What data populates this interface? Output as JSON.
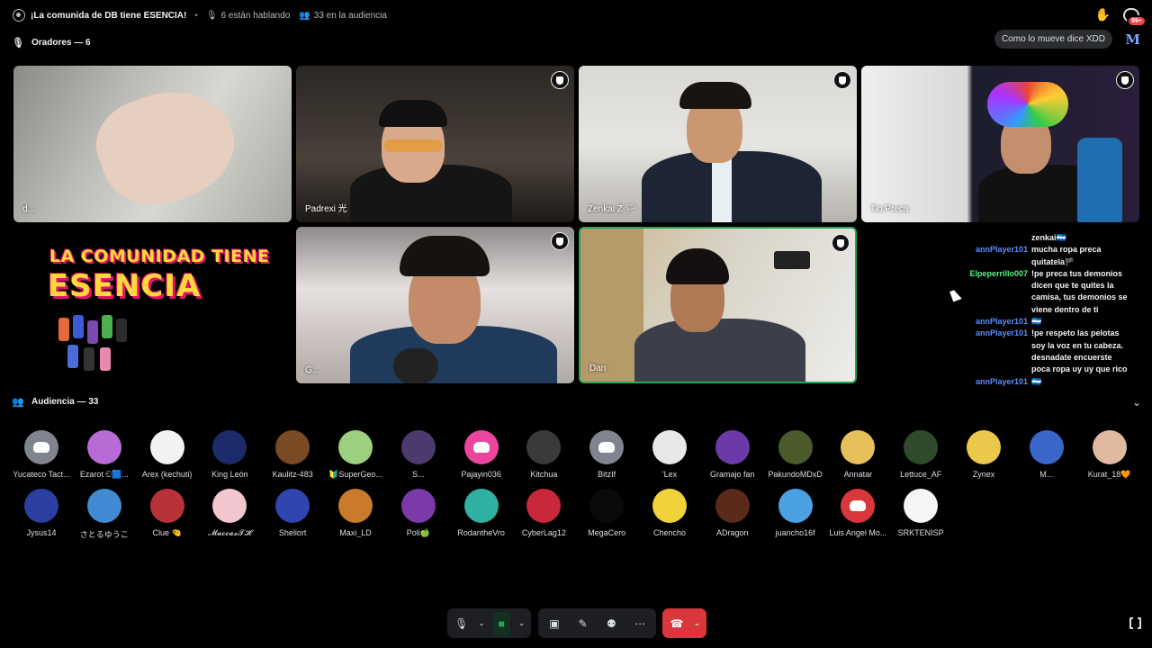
{
  "header": {
    "title": "¡La comunida de DB tiene ESENCIA!",
    "talking": "6 están hablando",
    "audience_count": "33 en la audiencia",
    "notif_badge": "99+"
  },
  "speakers": {
    "heading": "Oradores — 6",
    "tiles": [
      {
        "name": "d...",
        "moderator": false
      },
      {
        "name": "Padrexi 光",
        "moderator": true
      },
      {
        "name": "Zenkai Z 🏳",
        "moderator": true
      },
      {
        "name": "Tio Preca",
        "moderator": true
      },
      {
        "name": "G...",
        "moderator": true
      },
      {
        "name": "Dan",
        "moderator": true,
        "speaking": true
      }
    ]
  },
  "activity_pill": "Como lo mueve dice XDD",
  "brand_letter": "M",
  "banner": {
    "line1": "LA COMUNIDAD TIENE",
    "line2": "ESENCIA"
  },
  "chat": [
    {
      "user": "",
      "text": "zenkai🇭🇳",
      "color": "#5865f2"
    },
    {
      "user": "annPlayer101",
      "text": "mucha ropa preca",
      "color": "#5b8cff"
    },
    {
      "user": "",
      "text": "quitatela🏴",
      "color": "#5b8cff"
    },
    {
      "user": "Elpeperrillo007",
      "text": "!pe preca tus demonios",
      "color": "#57f287"
    },
    {
      "user": "",
      "text": "dicen que te quites la",
      "color": "#57f287"
    },
    {
      "user": "",
      "text": "camisa, tus demonios se",
      "color": "#57f287"
    },
    {
      "user": "",
      "text": "viene dentro de ti",
      "color": "#57f287"
    },
    {
      "user": "annPlayer101",
      "text": "🇭🇳",
      "color": "#5b8cff"
    },
    {
      "user": "annPlayer101",
      "text": "!pe respeto las pelotas",
      "color": "#5b8cff"
    },
    {
      "user": "",
      "text": "soy la voz en tu cabeza.",
      "color": "#5b8cff"
    },
    {
      "user": "",
      "text": "desnadate encuerste",
      "color": "#5b8cff"
    },
    {
      "user": "",
      "text": "poca ropa uy uy que rico",
      "color": "#5b8cff"
    },
    {
      "user": "annPlayer101",
      "text": "🇭🇳",
      "color": "#5b8cff"
    }
  ],
  "audience": {
    "heading": "Audiencia — 33",
    "members": [
      {
        "name": "Yucateco Tact...",
        "color": "#80848e",
        "discord": true
      },
      {
        "name": "Ezarot ඞ🟦...",
        "color": "#b86bd6"
      },
      {
        "name": "Arex (kechuti)",
        "color": "#f2f2f2"
      },
      {
        "name": "King León",
        "color": "#1d2b6b"
      },
      {
        "name": "Kaulitz-483",
        "color": "#7a4a24"
      },
      {
        "name": "🔰SuperGeo...",
        "color": "#9ccf7e"
      },
      {
        "name": "S...",
        "color": "#4b3a6e"
      },
      {
        "name": "Pajayin036",
        "color": "#eb459e",
        "discord": true
      },
      {
        "name": "Kitchua",
        "color": "#3a3a3a"
      },
      {
        "name": "BitzIf",
        "color": "#80848e",
        "discord": true
      },
      {
        "name": "'Lex",
        "color": "#e8e8e8"
      },
      {
        "name": "Gramajo fan",
        "color": "#6b3aa8"
      },
      {
        "name": "PakundoMDxD",
        "color": "#4a5a2a"
      },
      {
        "name": "Annatar",
        "color": "#e6c15a"
      },
      {
        "name": "Lettuce_AF",
        "color": "#2e4a2a"
      },
      {
        "name": "Zynex",
        "color": "#e9c84a"
      },
      {
        "name": "M...",
        "color": "#3a66c9"
      },
      {
        "name": "Kurat_18🧡",
        "color": "#e0b9a0"
      },
      {
        "name": "Jysus14",
        "color": "#2a3fa0"
      },
      {
        "name": "さとるゆうこ",
        "color": "#3f8ad0"
      },
      {
        "name": "Clue 🤏",
        "color": "#b8323a"
      },
      {
        "name": "𝓜𝓪𝓬𝓬𝓪𝔁𝓣𝓗",
        "color": "#f3c6cf"
      },
      {
        "name": "Sheliort",
        "color": "#2f45b0"
      },
      {
        "name": "Maxi_LD",
        "color": "#c97a2a"
      },
      {
        "name": "Poli🍏",
        "color": "#7b3aa8"
      },
      {
        "name": "RodantheVro",
        "color": "#2fb0a0"
      },
      {
        "name": "CyberLag12",
        "color": "#c8283a"
      },
      {
        "name": "MegaCero",
        "color": "#0a0a0a"
      },
      {
        "name": "Chencho",
        "color": "#f0d23a"
      },
      {
        "name": "ADragon",
        "color": "#5a2a1a"
      },
      {
        "name": "juancho16f",
        "color": "#4aa0e0"
      },
      {
        "name": "Luis Angel Mo...",
        "color": "#da373c",
        "discord": true
      },
      {
        "name": "SRKTENISP",
        "color": "#f5f5f5"
      }
    ]
  },
  "controls": {
    "mic_icon": "microphone-icon",
    "camera_icon": "camera-icon",
    "share_icon": "screen-share-icon",
    "activity_icon": "activity-icon",
    "invite_icon": "invite-icon",
    "more_icon": "more-icon",
    "end_icon": "end-call-icon",
    "fullscreen_icon": "fullscreen-icon"
  }
}
